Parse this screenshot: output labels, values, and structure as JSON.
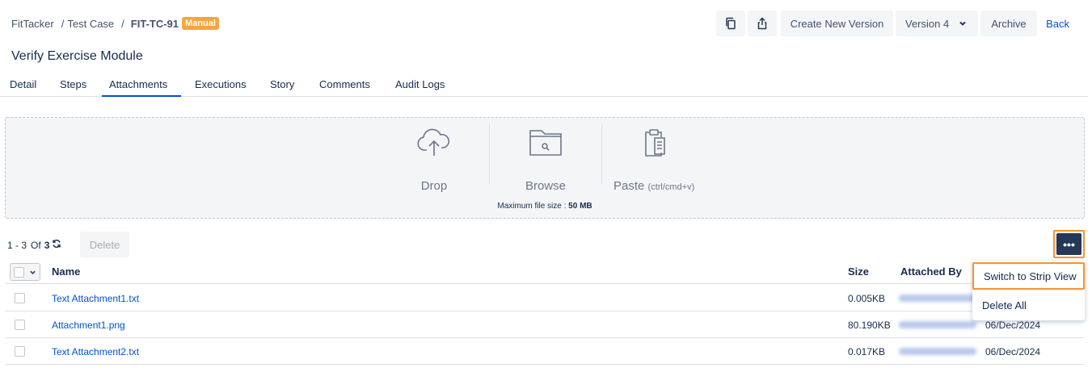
{
  "breadcrumb": {
    "project": "FitTacker",
    "section": "Test Case",
    "sep": "/",
    "id": "FIT-TC-91",
    "badge": "Manual"
  },
  "toolbar": {
    "clone_icon": "copy-icon",
    "share_icon": "share-icon",
    "create_version": "Create New Version",
    "version": "Version 4",
    "archive": "Archive",
    "back": "Back"
  },
  "title": "Verify Exercise Module",
  "tabs": [
    "Detail",
    "Steps",
    "Attachments",
    "Executions",
    "Story",
    "Comments",
    "Audit Logs"
  ],
  "active_tab": "Attachments",
  "dropzone": {
    "drop": "Drop",
    "browse": "Browse",
    "paste": "Paste",
    "paste_hint": "(ctrl/cmd+v)",
    "max_label": "Maximum file size :",
    "max_value": "50 MB"
  },
  "pager": {
    "range": "1 - 3",
    "of": "Of",
    "total": "3",
    "refresh_icon": "refresh-icon"
  },
  "delete_label": "Delete",
  "more_label": "•••",
  "table": {
    "headers": {
      "name": "Name",
      "size": "Size",
      "attached_by": "Attached By"
    },
    "rows": [
      {
        "name": "Text Attachment1.txt",
        "size": "0.005KB",
        "date": ""
      },
      {
        "name": "Attachment1.png",
        "size": "80.190KB",
        "date": "06/Dec/2024"
      },
      {
        "name": "Text Attachment2.txt",
        "size": "0.017KB",
        "date": "06/Dec/2024"
      }
    ]
  },
  "menu": {
    "strip_view": "Switch to Strip View",
    "delete_all": "Delete All"
  },
  "colors": {
    "accent": "#0052cc",
    "badge": "#f5a540",
    "highlight": "#f79232",
    "more_btn": "#253858"
  }
}
